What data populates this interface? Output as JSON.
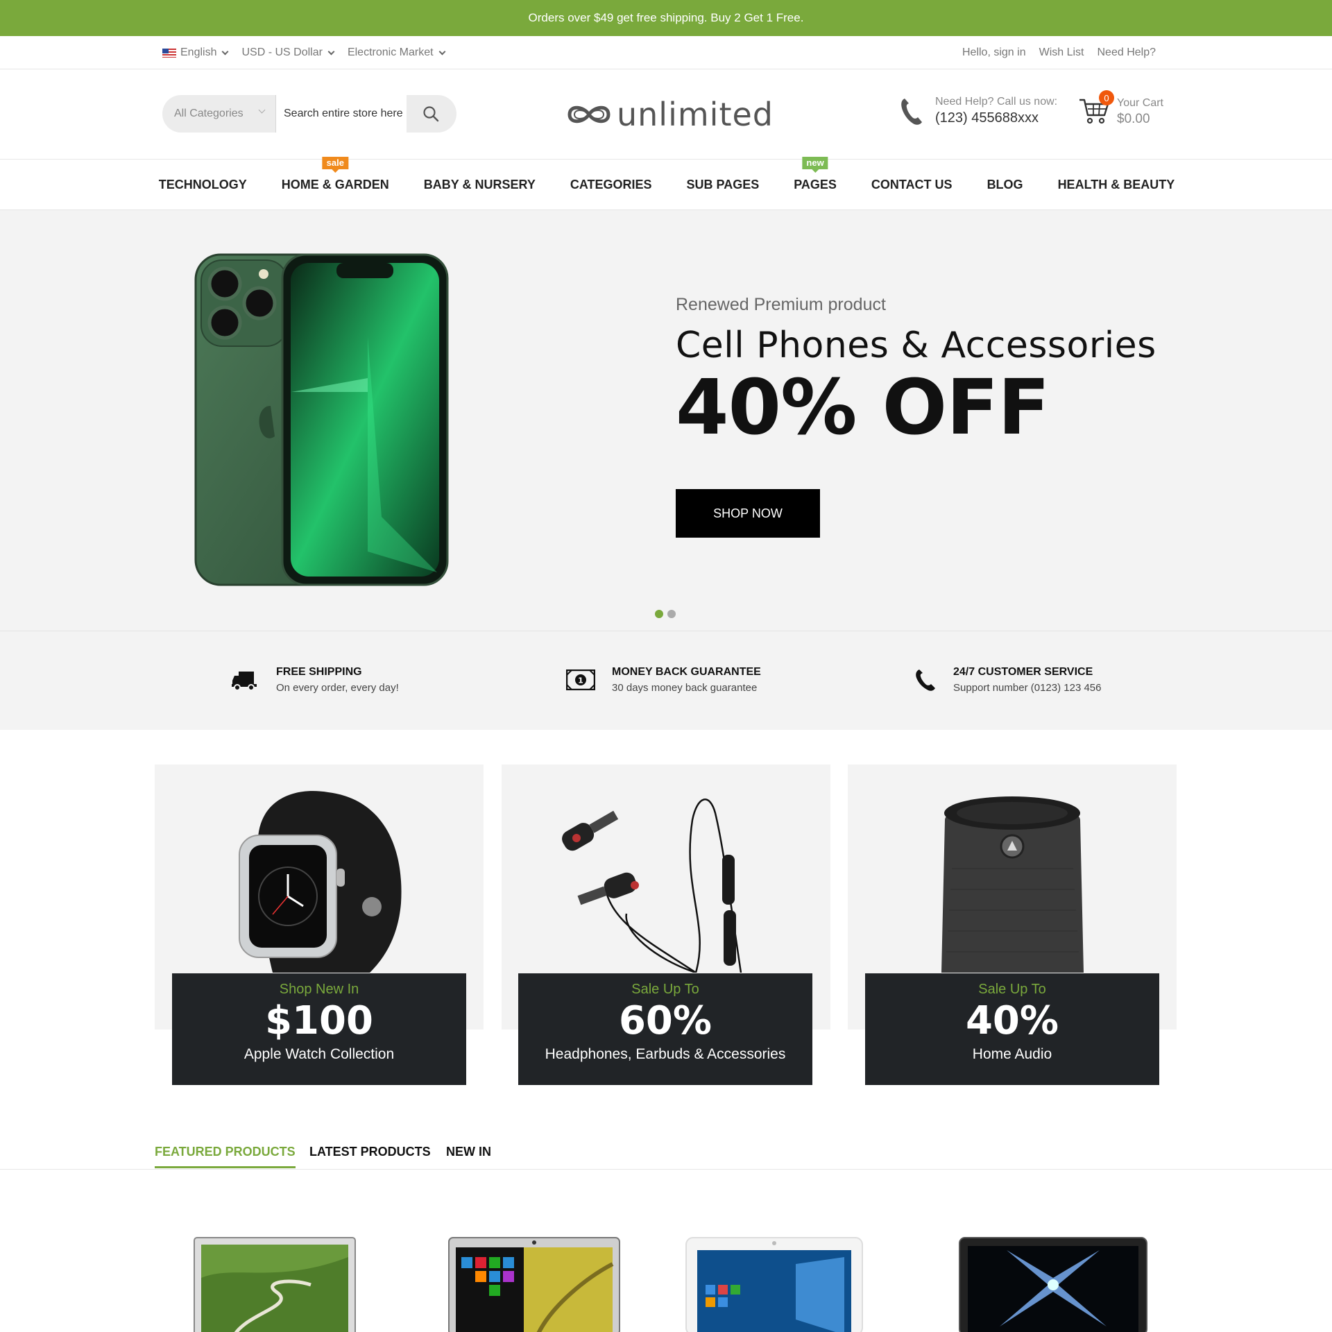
{
  "promo": {
    "text": "Orders over $49 get free shipping. Buy 2 Get 1 Free."
  },
  "topbar": {
    "language": "English",
    "currency": "USD - US Dollar",
    "store": "Electronic Market",
    "links": [
      "Hello, sign in",
      "Wish List",
      "Need Help?"
    ]
  },
  "header": {
    "search": {
      "category": "All Categories",
      "placeholder": "Search entire store here"
    },
    "logo": "unlimited",
    "help": {
      "label": "Need Help? Call us now:",
      "phone": "(123) 455688xxx"
    },
    "cart": {
      "count": "0",
      "label": "Your Cart",
      "total": "$0.00"
    }
  },
  "nav": {
    "items": [
      {
        "label": "TECHNOLOGY"
      },
      {
        "label": "HOME & GARDEN",
        "tag": "sale"
      },
      {
        "label": "BABY & NURSERY"
      },
      {
        "label": "CATEGORIES"
      },
      {
        "label": "SUB PAGES"
      },
      {
        "label": "PAGES",
        "tag": "new"
      },
      {
        "label": "CONTACT US"
      },
      {
        "label": "BLOG"
      },
      {
        "label": "HEALTH & BEAUTY"
      }
    ]
  },
  "hero": {
    "subtitle": "Renewed Premium product",
    "title": "Cell Phones & Accessories",
    "discount": "40% OFF",
    "button": "SHOP NOW",
    "slides": 2,
    "active_slide": 1
  },
  "features": [
    {
      "title": "FREE SHIPPING",
      "desc": "On every order, every day!",
      "icon": "truck-icon"
    },
    {
      "title": "MONEY BACK GUARANTEE",
      "desc": "30 days money back guarantee",
      "icon": "money-icon"
    },
    {
      "title": "24/7 CUSTOMER SERVICE",
      "desc": "Support number (0123) 123 456",
      "icon": "phone-icon"
    }
  ],
  "banners": [
    {
      "sub": "Shop New In",
      "big": "$100",
      "name": "Apple Watch Collection",
      "image": "smartwatch"
    },
    {
      "sub": "Sale Up To",
      "big": "60%",
      "name": "Headphones, Earbuds & Accessories",
      "image": "earbuds"
    },
    {
      "sub": "Sale Up To",
      "big": "40%",
      "name": "Home Audio",
      "image": "speaker"
    }
  ],
  "tabs": [
    "FEATURED PRODUCTS",
    "LATEST PRODUCTS",
    "NEW IN"
  ],
  "active_tab": 0,
  "colors": {
    "accent": "#7aa93c",
    "sale": "#f08a1c",
    "new": "#7dbb54",
    "badge": "#f0580c",
    "dark": "#212427"
  }
}
